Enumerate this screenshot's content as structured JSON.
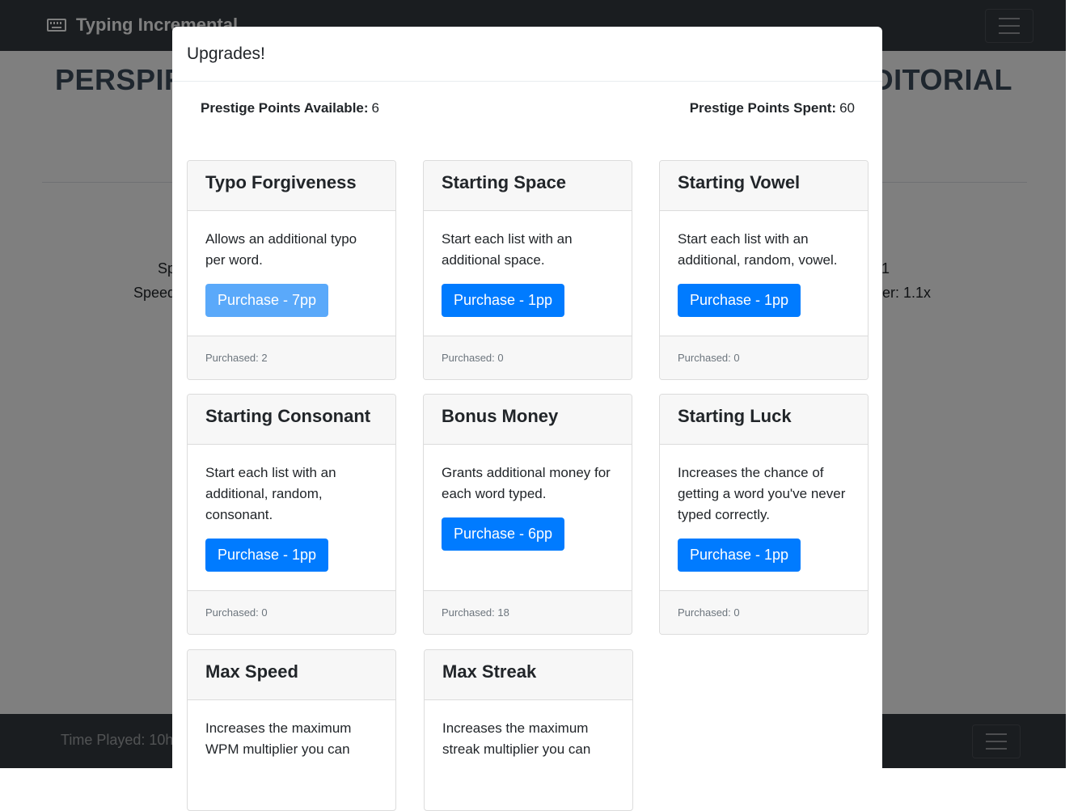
{
  "app": {
    "title": "Typing Incremental",
    "brand_icon": "keyboard-icon",
    "menu_icon": "hamburger-menu-icon"
  },
  "background": {
    "headline_left": "PERSPIRA",
    "headline_right": "EDITORIAL",
    "stat_left_1": "Sp",
    "stat_left_2": "Speed",
    "stat_right_1": "1",
    "stat_right_2": "er: 1.1x",
    "footer_time_played": "Time Played: 10h"
  },
  "modal": {
    "title": "Upgrades!",
    "points_available_label": "Prestige Points Available:",
    "points_available_value": "6",
    "points_spent_label": "Prestige Points Spent:",
    "points_spent_value": "60",
    "upgrades": [
      {
        "name": "Typo Forgiveness",
        "description": "Allows an additional typo per word.",
        "button": "Purchase - 7pp",
        "disabled": true,
        "purchased": "Purchased: 2"
      },
      {
        "name": "Starting Space",
        "description": "Start each list with an additional space.",
        "button": "Purchase - 1pp",
        "disabled": false,
        "purchased": "Purchased: 0"
      },
      {
        "name": "Starting Vowel",
        "description": "Start each list with an additional, random, vowel.",
        "button": "Purchase - 1pp",
        "disabled": false,
        "purchased": "Purchased: 0"
      },
      {
        "name": "Starting Consonant",
        "description": "Start each list with an additional, random, consonant.",
        "button": "Purchase - 1pp",
        "disabled": false,
        "purchased": "Purchased: 0"
      },
      {
        "name": "Bonus Money",
        "description": "Grants additional money for each word typed.",
        "button": "Purchase - 6pp",
        "disabled": false,
        "purchased": "Purchased: 18"
      },
      {
        "name": "Starting Luck",
        "description": "Increases the chance of getting a word you've never typed correctly.",
        "button": "Purchase - 1pp",
        "disabled": false,
        "purchased": "Purchased: 0"
      },
      {
        "name": "Max Speed",
        "description": "Increases the maximum WPM multiplier you can"
      },
      {
        "name": "Max Streak",
        "description": "Increases the maximum streak multiplier you can"
      }
    ]
  },
  "colors": {
    "primary": "#007bff",
    "primary_disabled": "#5aa9fa",
    "navbar": "#343a40"
  }
}
